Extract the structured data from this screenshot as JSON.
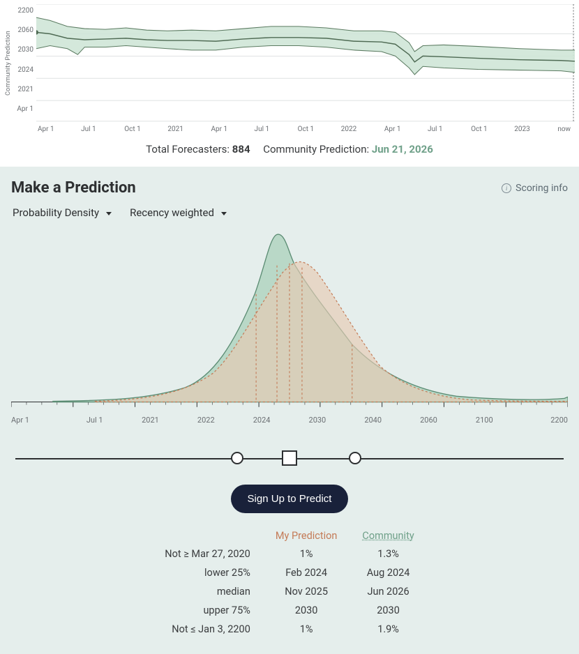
{
  "chart_data": [
    {
      "type": "fan",
      "title": "Community Prediction",
      "y_ticks": [
        "2200",
        "2060",
        "2030",
        "2024",
        "2021",
        "Apr 1"
      ],
      "x_ticks": [
        "Apr 1",
        "Jul 1",
        "Oct 1",
        "2021",
        "Apr 1",
        "Jul 1",
        "Oct 1",
        "2022",
        "Apr 1",
        "Jul 1",
        "Oct 1",
        "2023",
        "now"
      ],
      "series": [
        {
          "name": "community-median",
          "note": "date-valued forecast over time; IQR band shown; median stays near 2030–2060 range, ending ~Jun 2026"
        }
      ]
    },
    {
      "type": "density",
      "title": "Probability Density",
      "x_scale": "log-date",
      "x_ticks": [
        "Apr 1",
        "Jul 1",
        "2021",
        "2022",
        "2024",
        "2030",
        "2040",
        "2060",
        "2100",
        "2200"
      ],
      "series": [
        {
          "name": "Community",
          "color": "#6fa089",
          "peak_x": "~2025",
          "support": [
            "2021",
            "2200"
          ]
        },
        {
          "name": "My Prediction",
          "color": "#c47b57",
          "peak_x": "~2025–2026",
          "support": [
            "2021",
            "2100"
          ]
        }
      ],
      "my_quartiles": {
        "p25": "Feb 2024",
        "p50": "Nov 2025",
        "p75": "2030"
      },
      "community_quartiles": {
        "p25": "Aug 2024",
        "p50": "Jun 2026",
        "p75": "2030"
      }
    }
  ],
  "top": {
    "y_label": "Community Prediction",
    "y_ticks": {
      "0": "2200",
      "1": "2060",
      "2": "2030",
      "3": "2024",
      "4": "2021",
      "5": "Apr 1"
    },
    "x_ticks": {
      "0": "Apr 1",
      "1": "Jul 1",
      "2": "Oct 1",
      "3": "2021",
      "4": "Apr 1",
      "5": "Jul 1",
      "6": "Oct 1",
      "7": "2022",
      "8": "Apr 1",
      "9": "Jul 1",
      "10": "Oct 1",
      "11": "2023",
      "12": "now"
    }
  },
  "summary": {
    "forecasters_label": "Total Forecasters: ",
    "forecasters_value": "884",
    "community_label": "Community Prediction: ",
    "community_value": "Jun 21, 2026"
  },
  "panel": {
    "title": "Make a Prediction",
    "scoring_label": "Scoring info",
    "selector1": "Probability Density",
    "selector2": "Recency weighted",
    "x_ticks": {
      "0": "Apr 1",
      "1": "Jul 1",
      "2": "2021",
      "3": "2022",
      "4": "2024",
      "5": "2030",
      "6": "2040",
      "7": "2060",
      "8": "2100",
      "9": "2200"
    },
    "cta": "Sign Up to Predict"
  },
  "stats": {
    "head_mine": "My Prediction",
    "head_comm": "Community",
    "rows": {
      "0": {
        "label": "Not ≥ Mar 27, 2020",
        "mine": "1%",
        "comm": "1.3%"
      },
      "1": {
        "label": "lower 25%",
        "mine": "Feb 2024",
        "comm": "Aug 2024"
      },
      "2": {
        "label": "median",
        "mine": "Nov 2025",
        "comm": "Jun 2026"
      },
      "3": {
        "label": "upper 75%",
        "mine": "2030",
        "comm": "2030"
      },
      "4": {
        "label": "Not ≤ Jan 3, 2200",
        "mine": "1%",
        "comm": "1.9%"
      }
    }
  }
}
